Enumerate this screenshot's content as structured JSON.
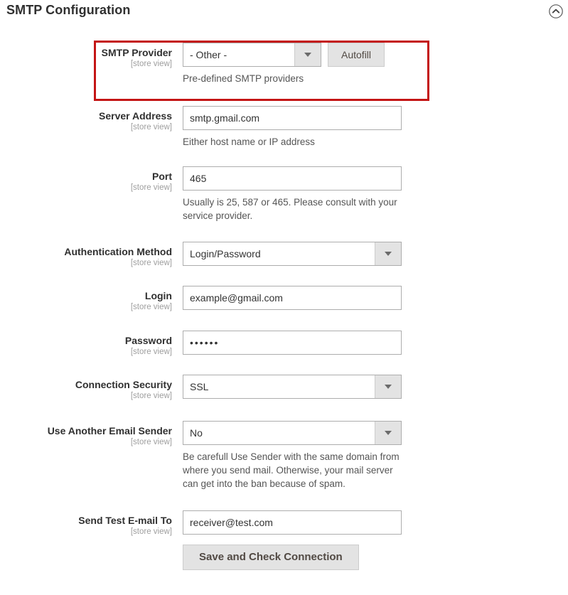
{
  "header": {
    "title": "SMTP Configuration",
    "collapse_icon": "chevron-up-circle-icon"
  },
  "scope_note": "[store view]",
  "highlight": {
    "color": "#c41515",
    "target": "smtp-provider-row"
  },
  "fields": {
    "smtp_provider": {
      "label": "SMTP Provider",
      "scope": "[store view]",
      "value": "- Other -",
      "button_label": "Autofill",
      "help": "Pre-defined SMTP providers"
    },
    "server_address": {
      "label": "Server Address",
      "scope": "[store view]",
      "value": "smtp.gmail.com",
      "help": "Either host name or IP address"
    },
    "port": {
      "label": "Port",
      "scope": "[store view]",
      "value": "465",
      "help": "Usually is 25, 587 or 465. Please consult with your service provider."
    },
    "auth_method": {
      "label": "Authentication Method",
      "scope": "[store view]",
      "value": "Login/Password"
    },
    "login": {
      "label": "Login",
      "scope": "[store view]",
      "value": "example@gmail.com"
    },
    "password": {
      "label": "Password",
      "scope": "[store view]",
      "value": "••••••"
    },
    "connection_security": {
      "label": "Connection Security",
      "scope": "[store view]",
      "value": "SSL"
    },
    "use_another_sender": {
      "label": "Use Another Email Sender",
      "scope": "[store view]",
      "value": "No",
      "help": "Be carefull Use Sender with the same domain from where you send mail. Otherwise, your mail server can get into the ban because of spam."
    },
    "send_test_email": {
      "label": "Send Test E-mail To",
      "scope": "[store view]",
      "value": "receiver@test.com"
    }
  },
  "actions": {
    "save_check_label": "Save and Check Connection"
  }
}
